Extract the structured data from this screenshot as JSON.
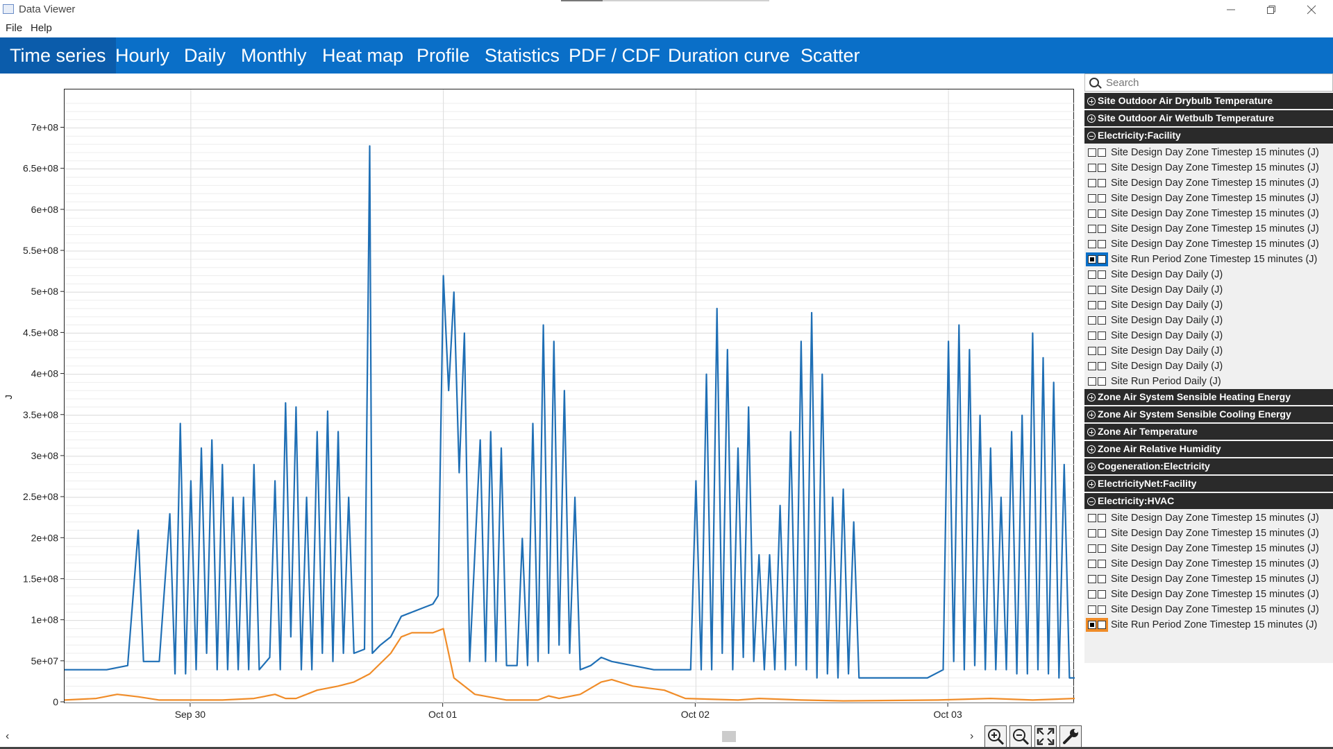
{
  "window": {
    "title": "Data Viewer"
  },
  "menu": [
    "File",
    "Help"
  ],
  "tabs": [
    "Time series",
    "Hourly",
    "Daily",
    "Monthly",
    "Heat map",
    "Profile",
    "Statistics",
    "PDF / CDF",
    "Duration curve",
    "Scatter"
  ],
  "active_tab": "Time series",
  "search": {
    "placeholder": "Search"
  },
  "tree": [
    {
      "group": "Site Outdoor Air Drybulb Temperature",
      "expanded": false
    },
    {
      "group": "Site Outdoor Air Wetbulb Temperature",
      "expanded": false
    },
    {
      "group": "Electricity:Facility",
      "expanded": true,
      "items": [
        {
          "label": "Site Design Day Zone Timestep 15 minutes (J)"
        },
        {
          "label": "Site Design Day Zone Timestep 15 minutes (J)"
        },
        {
          "label": "Site Design Day Zone Timestep 15 minutes (J)"
        },
        {
          "label": "Site Design Day Zone Timestep 15 minutes (J)"
        },
        {
          "label": "Site Design Day Zone Timestep 15 minutes (J)"
        },
        {
          "label": "Site Design Day Zone Timestep 15 minutes (J)"
        },
        {
          "label": "Site Design Day Zone Timestep 15 minutes (J)"
        },
        {
          "label": "Site Run Period Zone Timestep 15 minutes (J)",
          "checked": true,
          "color": "#0a6fc8"
        },
        {
          "label": "Site Design Day Daily (J)"
        },
        {
          "label": "Site Design Day Daily (J)"
        },
        {
          "label": "Site Design Day Daily (J)"
        },
        {
          "label": "Site Design Day Daily (J)"
        },
        {
          "label": "Site Design Day Daily (J)"
        },
        {
          "label": "Site Design Day Daily (J)"
        },
        {
          "label": "Site Design Day Daily (J)"
        },
        {
          "label": "Site Run Period Daily (J)"
        }
      ]
    },
    {
      "group": "Zone Air System Sensible Heating Energy",
      "expanded": false
    },
    {
      "group": "Zone Air System Sensible Cooling Energy",
      "expanded": false
    },
    {
      "group": "Zone Air Temperature",
      "expanded": false
    },
    {
      "group": "Zone Air Relative Humidity",
      "expanded": false
    },
    {
      "group": "Cogeneration:Electricity",
      "expanded": false
    },
    {
      "group": "ElectricityNet:Facility",
      "expanded": false
    },
    {
      "group": "Electricity:HVAC",
      "expanded": true,
      "items": [
        {
          "label": "Site Design Day Zone Timestep 15 minutes (J)"
        },
        {
          "label": "Site Design Day Zone Timestep 15 minutes (J)"
        },
        {
          "label": "Site Design Day Zone Timestep 15 minutes (J)"
        },
        {
          "label": "Site Design Day Zone Timestep 15 minutes (J)"
        },
        {
          "label": "Site Design Day Zone Timestep 15 minutes (J)"
        },
        {
          "label": "Site Design Day Zone Timestep 15 minutes (J)"
        },
        {
          "label": "Site Design Day Zone Timestep 15 minutes (J)"
        },
        {
          "label": "Site Run Period Zone Timestep 15 minutes (J)",
          "checked": true,
          "color": "#f08c28"
        }
      ]
    }
  ],
  "toolbar": {
    "icons": [
      "zoom-in-icon",
      "zoom-out-icon",
      "fit-icon",
      "settings-icon"
    ]
  },
  "chart_data": {
    "type": "line",
    "ylabel": "J",
    "ylim": [
      0,
      730000000
    ],
    "yticks": [
      0,
      50000000,
      100000000,
      150000000,
      200000000,
      250000000,
      300000000,
      350000000,
      400000000,
      450000000,
      500000000,
      550000000,
      600000000,
      650000000,
      700000000
    ],
    "ytick_labels": [
      "0",
      "5e+07",
      "1e+08",
      "1.5e+08",
      "2e+08",
      "2.5e+08",
      "3e+08",
      "3.5e+08",
      "4e+08",
      "4.5e+08",
      "5e+08",
      "5.5e+08",
      "6e+08",
      "6.5e+08",
      "7e+08"
    ],
    "xlim": [
      "2021-09-29T12:00",
      "2021-10-03T12:00"
    ],
    "xticks": [
      "2021-09-30T00:00",
      "2021-10-01T00:00",
      "2021-10-02T00:00",
      "2021-10-03T00:00"
    ],
    "xtick_labels": [
      "Sep 30",
      "Oct 01",
      "Oct 02",
      "Oct 03"
    ],
    "grid": true,
    "series": [
      {
        "color": "#1f6fb5",
        "points": [
          [
            "2021-09-29T12:00",
            40000000
          ],
          [
            "2021-09-29T16:00",
            40000000
          ],
          [
            "2021-09-29T18:00",
            45000000
          ],
          [
            "2021-09-29T19:00",
            210000000
          ],
          [
            "2021-09-29T19:30",
            50000000
          ],
          [
            "2021-09-29T21:00",
            50000000
          ],
          [
            "2021-09-29T22:00",
            230000000
          ],
          [
            "2021-09-29T22:30",
            35000000
          ],
          [
            "2021-09-29T23:00",
            340000000
          ],
          [
            "2021-09-29T23:30",
            35000000
          ],
          [
            "2021-09-30T00:00",
            270000000
          ],
          [
            "2021-09-30T00:30",
            40000000
          ],
          [
            "2021-09-30T01:00",
            310000000
          ],
          [
            "2021-09-30T01:30",
            60000000
          ],
          [
            "2021-09-30T02:00",
            320000000
          ],
          [
            "2021-09-30T02:30",
            40000000
          ],
          [
            "2021-09-30T03:00",
            290000000
          ],
          [
            "2021-09-30T03:30",
            40000000
          ],
          [
            "2021-09-30T04:00",
            250000000
          ],
          [
            "2021-09-30T04:30",
            40000000
          ],
          [
            "2021-09-30T05:00",
            250000000
          ],
          [
            "2021-09-30T05:30",
            40000000
          ],
          [
            "2021-09-30T06:00",
            290000000
          ],
          [
            "2021-09-30T06:30",
            40000000
          ],
          [
            "2021-09-30T07:30",
            55000000
          ],
          [
            "2021-09-30T08:00",
            270000000
          ],
          [
            "2021-09-30T08:30",
            40000000
          ],
          [
            "2021-09-30T09:00",
            365000000
          ],
          [
            "2021-09-30T09:30",
            80000000
          ],
          [
            "2021-09-30T10:00",
            360000000
          ],
          [
            "2021-09-30T10:30",
            40000000
          ],
          [
            "2021-09-30T11:00",
            250000000
          ],
          [
            "2021-09-30T11:30",
            40000000
          ],
          [
            "2021-09-30T12:00",
            330000000
          ],
          [
            "2021-09-30T12:30",
            60000000
          ],
          [
            "2021-09-30T13:00",
            355000000
          ],
          [
            "2021-09-30T13:30",
            50000000
          ],
          [
            "2021-09-30T14:00",
            330000000
          ],
          [
            "2021-09-30T14:30",
            60000000
          ],
          [
            "2021-09-30T15:00",
            250000000
          ],
          [
            "2021-09-30T15:30",
            60000000
          ],
          [
            "2021-09-30T16:30",
            65000000
          ],
          [
            "2021-09-30T17:00",
            678000000
          ],
          [
            "2021-09-30T17:15",
            60000000
          ],
          [
            "2021-09-30T18:00",
            70000000
          ],
          [
            "2021-09-30T19:00",
            80000000
          ],
          [
            "2021-09-30T20:00",
            105000000
          ],
          [
            "2021-09-30T22:00",
            115000000
          ],
          [
            "2021-09-30T23:00",
            120000000
          ],
          [
            "2021-09-30T23:30",
            130000000
          ],
          [
            "2021-10-01T00:00",
            520000000
          ],
          [
            "2021-10-01T00:30",
            380000000
          ],
          [
            "2021-10-01T01:00",
            500000000
          ],
          [
            "2021-10-01T01:30",
            280000000
          ],
          [
            "2021-10-01T02:00",
            450000000
          ],
          [
            "2021-10-01T02:30",
            50000000
          ],
          [
            "2021-10-01T03:30",
            320000000
          ],
          [
            "2021-10-01T04:00",
            50000000
          ],
          [
            "2021-10-01T04:30",
            330000000
          ],
          [
            "2021-10-01T05:00",
            50000000
          ],
          [
            "2021-10-01T05:30",
            310000000
          ],
          [
            "2021-10-01T06:00",
            45000000
          ],
          [
            "2021-10-01T07:00",
            45000000
          ],
          [
            "2021-10-01T07:30",
            200000000
          ],
          [
            "2021-10-01T08:00",
            45000000
          ],
          [
            "2021-10-01T08:30",
            340000000
          ],
          [
            "2021-10-01T09:00",
            50000000
          ],
          [
            "2021-10-01T09:30",
            460000000
          ],
          [
            "2021-10-01T10:00",
            60000000
          ],
          [
            "2021-10-01T10:30",
            440000000
          ],
          [
            "2021-10-01T11:00",
            70000000
          ],
          [
            "2021-10-01T11:30",
            380000000
          ],
          [
            "2021-10-01T12:00",
            60000000
          ],
          [
            "2021-10-01T12:30",
            250000000
          ],
          [
            "2021-10-01T13:00",
            40000000
          ],
          [
            "2021-10-01T14:00",
            45000000
          ],
          [
            "2021-10-01T15:00",
            55000000
          ],
          [
            "2021-10-01T16:00",
            50000000
          ],
          [
            "2021-10-01T18:00",
            45000000
          ],
          [
            "2021-10-01T20:00",
            40000000
          ],
          [
            "2021-10-01T23:30",
            40000000
          ],
          [
            "2021-10-02T00:00",
            270000000
          ],
          [
            "2021-10-02T00:30",
            40000000
          ],
          [
            "2021-10-02T01:00",
            400000000
          ],
          [
            "2021-10-02T01:30",
            40000000
          ],
          [
            "2021-10-02T02:00",
            480000000
          ],
          [
            "2021-10-02T02:30",
            60000000
          ],
          [
            "2021-10-02T03:00",
            430000000
          ],
          [
            "2021-10-02T03:30",
            40000000
          ],
          [
            "2021-10-02T04:00",
            310000000
          ],
          [
            "2021-10-02T04:30",
            55000000
          ],
          [
            "2021-10-02T05:00",
            360000000
          ],
          [
            "2021-10-02T05:30",
            50000000
          ],
          [
            "2021-10-02T06:00",
            180000000
          ],
          [
            "2021-10-02T06:30",
            40000000
          ],
          [
            "2021-10-02T07:00",
            180000000
          ],
          [
            "2021-10-02T07:30",
            40000000
          ],
          [
            "2021-10-02T08:00",
            240000000
          ],
          [
            "2021-10-02T08:30",
            40000000
          ],
          [
            "2021-10-02T09:00",
            330000000
          ],
          [
            "2021-10-02T09:30",
            45000000
          ],
          [
            "2021-10-02T10:00",
            440000000
          ],
          [
            "2021-10-02T10:30",
            40000000
          ],
          [
            "2021-10-02T11:00",
            475000000
          ],
          [
            "2021-10-02T11:30",
            30000000
          ],
          [
            "2021-10-02T12:00",
            400000000
          ],
          [
            "2021-10-02T12:30",
            35000000
          ],
          [
            "2021-10-02T13:00",
            250000000
          ],
          [
            "2021-10-02T13:30",
            30000000
          ],
          [
            "2021-10-02T14:00",
            260000000
          ],
          [
            "2021-10-02T14:30",
            35000000
          ],
          [
            "2021-10-02T15:00",
            220000000
          ],
          [
            "2021-10-02T15:30",
            30000000
          ],
          [
            "2021-10-02T18:00",
            30000000
          ],
          [
            "2021-10-02T22:00",
            30000000
          ],
          [
            "2021-10-02T23:30",
            40000000
          ],
          [
            "2021-10-03T00:00",
            440000000
          ],
          [
            "2021-10-03T00:30",
            50000000
          ],
          [
            "2021-10-03T01:00",
            460000000
          ],
          [
            "2021-10-03T01:30",
            40000000
          ],
          [
            "2021-10-03T02:00",
            430000000
          ],
          [
            "2021-10-03T02:30",
            45000000
          ],
          [
            "2021-10-03T03:00",
            350000000
          ],
          [
            "2021-10-03T03:30",
            40000000
          ],
          [
            "2021-10-03T04:00",
            310000000
          ],
          [
            "2021-10-03T04:30",
            40000000
          ],
          [
            "2021-10-03T05:00",
            250000000
          ],
          [
            "2021-10-03T05:30",
            40000000
          ],
          [
            "2021-10-03T06:00",
            330000000
          ],
          [
            "2021-10-03T06:30",
            35000000
          ],
          [
            "2021-10-03T07:00",
            350000000
          ],
          [
            "2021-10-03T07:30",
            35000000
          ],
          [
            "2021-10-03T08:00",
            450000000
          ],
          [
            "2021-10-03T08:30",
            40000000
          ],
          [
            "2021-10-03T09:00",
            420000000
          ],
          [
            "2021-10-03T09:30",
            35000000
          ],
          [
            "2021-10-03T10:00",
            390000000
          ],
          [
            "2021-10-03T10:30",
            30000000
          ],
          [
            "2021-10-03T11:00",
            290000000
          ],
          [
            "2021-10-03T11:30",
            30000000
          ],
          [
            "2021-10-03T12:00",
            30000000
          ]
        ]
      },
      {
        "color": "#f08c28",
        "points": [
          [
            "2021-09-29T12:00",
            3000000
          ],
          [
            "2021-09-29T15:00",
            5000000
          ],
          [
            "2021-09-29T17:00",
            10000000
          ],
          [
            "2021-09-29T19:00",
            7000000
          ],
          [
            "2021-09-29T21:00",
            3000000
          ],
          [
            "2021-09-30T03:00",
            3000000
          ],
          [
            "2021-09-30T06:00",
            5000000
          ],
          [
            "2021-09-30T08:00",
            10000000
          ],
          [
            "2021-09-30T09:00",
            5000000
          ],
          [
            "2021-09-30T10:00",
            5000000
          ],
          [
            "2021-09-30T12:00",
            15000000
          ],
          [
            "2021-09-30T14:00",
            20000000
          ],
          [
            "2021-09-30T15:30",
            25000000
          ],
          [
            "2021-09-30T17:00",
            35000000
          ],
          [
            "2021-09-30T19:00",
            60000000
          ],
          [
            "2021-09-30T20:00",
            80000000
          ],
          [
            "2021-09-30T21:00",
            85000000
          ],
          [
            "2021-09-30T23:00",
            85000000
          ],
          [
            "2021-10-01T00:00",
            90000000
          ],
          [
            "2021-10-01T01:00",
            30000000
          ],
          [
            "2021-10-01T03:00",
            10000000
          ],
          [
            "2021-10-01T06:00",
            3000000
          ],
          [
            "2021-10-01T09:00",
            3000000
          ],
          [
            "2021-10-01T10:00",
            8000000
          ],
          [
            "2021-10-01T11:00",
            5000000
          ],
          [
            "2021-10-01T13:00",
            10000000
          ],
          [
            "2021-10-01T15:00",
            25000000
          ],
          [
            "2021-10-01T16:00",
            28000000
          ],
          [
            "2021-10-01T18:00",
            20000000
          ],
          [
            "2021-10-01T21:00",
            15000000
          ],
          [
            "2021-10-01T23:00",
            5000000
          ],
          [
            "2021-10-02T04:00",
            3000000
          ],
          [
            "2021-10-02T06:00",
            5000000
          ],
          [
            "2021-10-02T10:00",
            3000000
          ],
          [
            "2021-10-02T14:00",
            2000000
          ],
          [
            "2021-10-02T23:00",
            3000000
          ],
          [
            "2021-10-03T04:00",
            5000000
          ],
          [
            "2021-10-03T08:00",
            3000000
          ],
          [
            "2021-10-03T12:00",
            5000000
          ]
        ]
      }
    ]
  }
}
